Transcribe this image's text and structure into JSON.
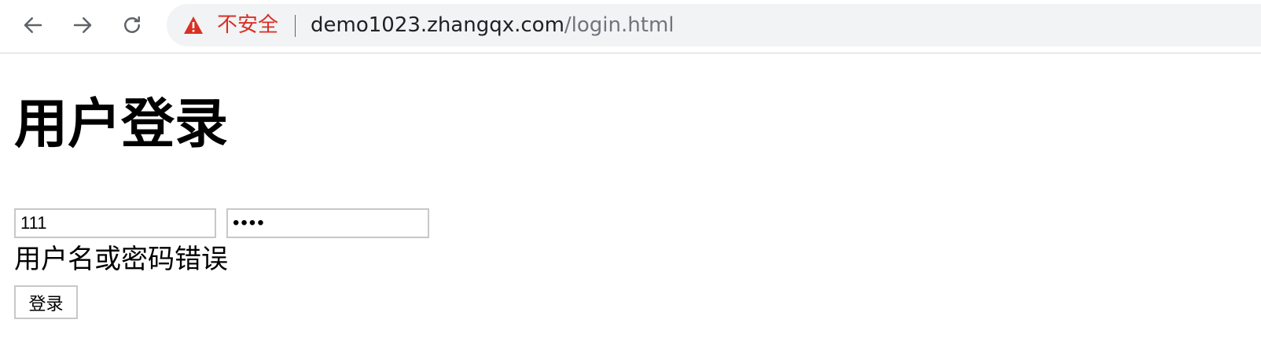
{
  "browser": {
    "nav": {
      "back_icon": "arrow-left-icon",
      "forward_icon": "arrow-right-icon",
      "reload_icon": "reload-icon"
    },
    "omnibox": {
      "security_icon": "warning-triangle-icon",
      "security_label": "不安全",
      "url_host": "demo1023.zhangqx.com",
      "url_path": "/login.html",
      "security_color": "#d93025"
    }
  },
  "page": {
    "title": "用户登录",
    "username_value": "111",
    "password_value": "1234",
    "error_message": "用户名或密码错误",
    "login_button_label": "登录"
  }
}
